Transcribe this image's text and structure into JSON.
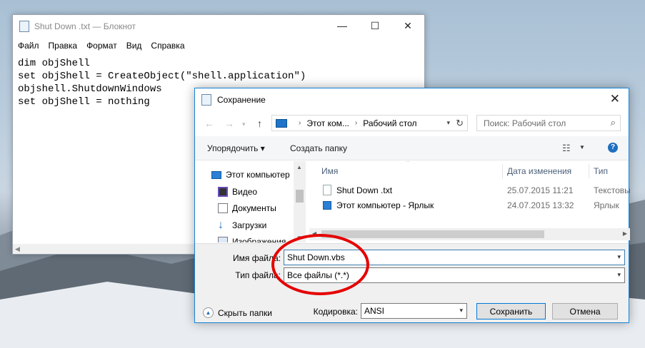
{
  "notepad": {
    "title": "Shut Down .txt — Блокнот",
    "window_buttons": [
      "—",
      "☐",
      "✕"
    ],
    "menu": [
      "Файл",
      "Правка",
      "Формат",
      "Вид",
      "Справка"
    ],
    "lines": [
      "dim objShell",
      "set objShell = CreateObject(\"shell.application\")",
      "objshell.ShutdownWindows",
      "set objShell = nothing"
    ]
  },
  "dialog": {
    "title": "Сохранение",
    "address": {
      "segments": [
        "Этот ком...",
        "Рабочий стол"
      ]
    },
    "search": {
      "placeholder": "Поиск: Рабочий стол"
    },
    "toolbar": {
      "organize": "Упорядочить ▾",
      "new_folder": "Создать папку"
    },
    "nav": [
      {
        "label": "Этот компьютер",
        "icon": "computer-icon"
      },
      {
        "label": "Видео",
        "icon": "video-icon"
      },
      {
        "label": "Документы",
        "icon": "documents-icon"
      },
      {
        "label": "Загрузки",
        "icon": "downloads-icon"
      },
      {
        "label": "Изображения",
        "icon": "pictures-icon"
      }
    ],
    "columns": [
      "Имя",
      "Дата изменения",
      "Тип"
    ],
    "files": [
      {
        "name": "Shut Down .txt",
        "date": "25.07.2015 11:21",
        "type": "Текстовый",
        "icon": "text-file-icon"
      },
      {
        "name": "Этот компьютер - Ярлык",
        "date": "24.07.2015 13:32",
        "type": "Ярлык",
        "icon": "shortcut-icon"
      }
    ],
    "filename_label": "Имя файла:",
    "filename_value": "Shut Down.vbs",
    "filetype_label": "Тип файла:",
    "filetype_value": "Все файлы  (*.*)",
    "encoding_label": "Кодировка:",
    "encoding_value": "ANSI",
    "hide_folders": "Скрыть папки",
    "save_button": "Сохранить",
    "cancel_button": "Отмена"
  },
  "colors": {
    "annotation_circle": "#e50000",
    "accent": "#0078d7"
  }
}
